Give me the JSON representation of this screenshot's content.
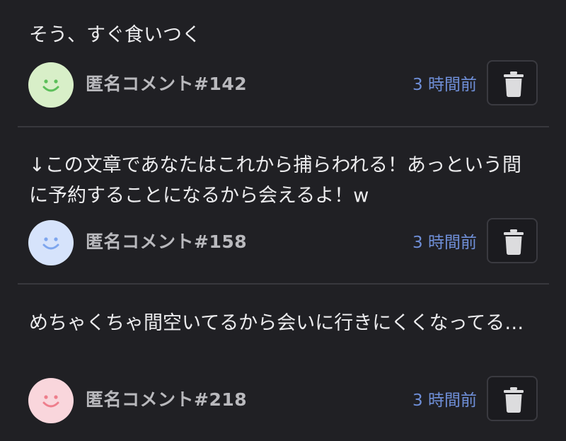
{
  "comments": [
    {
      "text": "そう、すぐ食いつく",
      "author": "匿名コメント#142",
      "time": "3 時間前",
      "avatar_bg": "#d8efc8",
      "avatar_fg": "#5cbf5a",
      "avatar_icon": "smiley-face-icon",
      "delete_icon": "trash-icon"
    },
    {
      "text": "↓この文章であなたはこれから捕らわれる！あっという間に予約することになるから会えるよ！w",
      "author": "匿名コメント#158",
      "time": "3 時間前",
      "avatar_bg": "#d6e3fb",
      "avatar_fg": "#7ea6ee",
      "avatar_icon": "smiley-face-icon",
      "delete_icon": "trash-icon"
    },
    {
      "text": "めちゃくちゃ間空いてるから会いに行きにくくなってる…",
      "author": "匿名コメント#218",
      "time": "3 時間前",
      "avatar_bg": "#f9d6dc",
      "avatar_fg": "#ee7e8c",
      "avatar_icon": "smiley-face-icon",
      "delete_icon": "trash-icon"
    }
  ]
}
